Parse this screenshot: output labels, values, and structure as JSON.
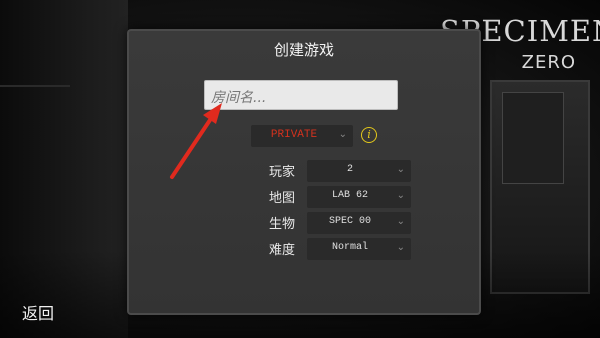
{
  "logo": {
    "main": "SPECIMEN",
    "sub": "ZERO"
  },
  "dialog": {
    "title": "创建游戏",
    "room_name": {
      "placeholder": "房间名...",
      "value": ""
    },
    "privacy": {
      "value": "PRIVATE"
    },
    "rows": [
      {
        "label": "玩家",
        "value": "2"
      },
      {
        "label": "地图",
        "value": "LAB 62"
      },
      {
        "label": "生物",
        "value": "SPEC 00"
      },
      {
        "label": "难度",
        "value": "Normal"
      }
    ]
  },
  "back_label": "返回",
  "colors": {
    "accent": "#d4321e",
    "info": "#e3c81b",
    "arrow": "#e02a1e"
  },
  "icons": {
    "info": "info-icon",
    "chevron": "chevron-down-icon",
    "annotation": "arrow-annotation"
  }
}
